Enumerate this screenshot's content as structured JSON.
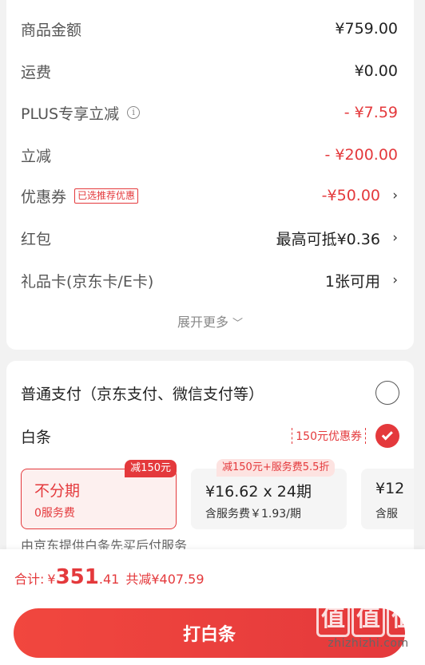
{
  "price_detail": {
    "goods_amount": {
      "label": "商品金额",
      "value": "¥759.00"
    },
    "shipping": {
      "label": "运费",
      "value": "¥0.00"
    },
    "plus_discount": {
      "label": "PLUS专享立减",
      "value": "- ¥7.59"
    },
    "instant_discount": {
      "label": "立减",
      "value": "- ¥200.00"
    },
    "coupon": {
      "label": "优惠券",
      "tag": "已选推荐优惠",
      "value": "-¥50.00"
    },
    "red_packet": {
      "label": "红包",
      "value": "最高可抵¥0.36"
    },
    "gift_card": {
      "label": "礼品卡(京东卡/E卡)",
      "value": "1张可用"
    },
    "expand_more": "展开更多"
  },
  "payment": {
    "normal": {
      "label": "普通支付（京东支付、微信支付等）"
    },
    "baitiao": {
      "label": "白条",
      "coupon": "150元优惠券"
    },
    "plans": [
      {
        "badge": "减150元",
        "title": "不分期",
        "sub": "0服务费"
      },
      {
        "badge": "减150元+服务费5.5折",
        "title": "¥16.62 x 24期",
        "sub": "含服务费￥1.93/期"
      },
      {
        "title": "¥12",
        "sub": "含服"
      }
    ],
    "provider_note": "由京东提供白条先买后付服务"
  },
  "bottom": {
    "total_label": "合计:",
    "currency": "¥",
    "total_int": "351",
    "total_dec": ".41",
    "saved": "共减¥407.59",
    "pay_button": "打白条"
  },
  "watermark": {
    "logo_text": "值值值",
    "url": "zhizhizhi.com"
  },
  "colors": {
    "accent": "#e4393c",
    "background": "#f2f2f2"
  }
}
